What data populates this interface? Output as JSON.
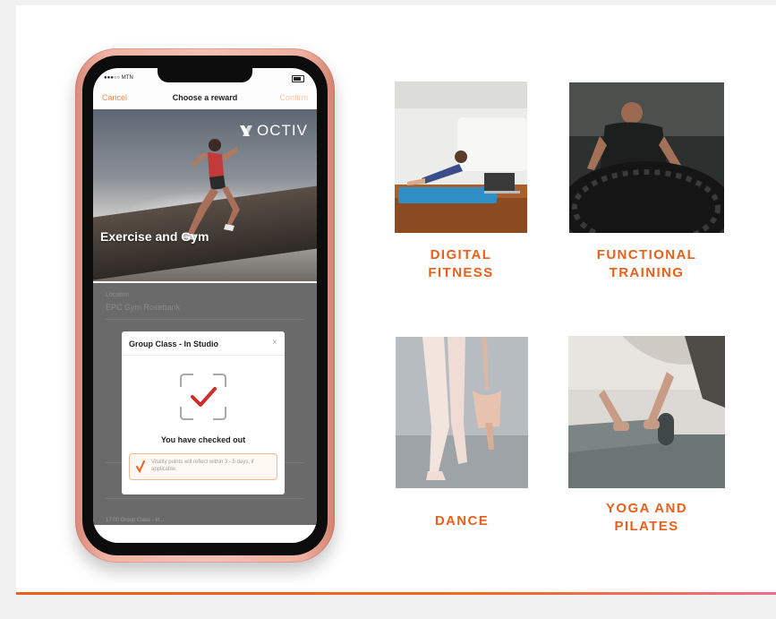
{
  "phone": {
    "status": {
      "carrier": "●●●○○ MTN"
    },
    "nav": {
      "cancel": "Cancel",
      "title": "Choose a reward",
      "confirm": "Confirm"
    },
    "hero": {
      "brand": "OCTIV",
      "title": "Exercise and Gym"
    },
    "list": {
      "location_label": "Location",
      "location_value": "EPC Gym Rosebank",
      "bottom_row": "17:00    Group Class - In..."
    },
    "modal": {
      "title": "Group Class - In Studio",
      "close": "×",
      "message": "You have checked out",
      "notice": "Vitality points will reflect within 3 - 5 days, if applicable."
    }
  },
  "tiles": [
    {
      "label": "DIGITAL\nFITNESS",
      "icon": "digital-fitness-photo"
    },
    {
      "label": "FUNCTIONAL\nTRAINING",
      "icon": "functional-training-photo"
    },
    {
      "label": "DANCE",
      "icon": "dance-photo"
    },
    {
      "label": "YOGA AND\nPILATES",
      "icon": "yoga-pilates-photo"
    }
  ],
  "colors": {
    "accent": "#e8601c",
    "phone_frame": "#f0b4a6",
    "notice_border": "#f0b791"
  }
}
